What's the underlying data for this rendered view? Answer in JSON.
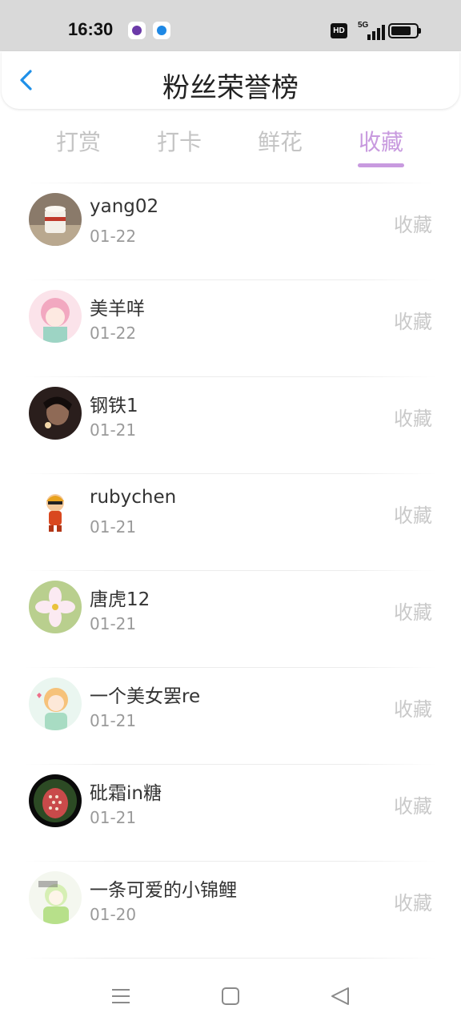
{
  "status_bar": {
    "time": "16:30",
    "network_label": "HD",
    "signal_label": "5G",
    "icons": [
      "app-notification-icon",
      "app-notification-icon",
      "hd-icon",
      "signal-icon",
      "battery-icon"
    ]
  },
  "header": {
    "title": "粉丝荣誉榜",
    "back_icon": "back-arrow-icon"
  },
  "tabs": [
    {
      "label": "打赏",
      "active": false
    },
    {
      "label": "打卡",
      "active": false
    },
    {
      "label": "鲜花",
      "active": false
    },
    {
      "label": "收藏",
      "active": true
    }
  ],
  "list": [
    {
      "name": "yang02",
      "date": "01-22",
      "action": "收藏"
    },
    {
      "name": "美羊咩",
      "date": "01-22",
      "action": "收藏"
    },
    {
      "name": "钢铁1",
      "date": "01-21",
      "action": "收藏"
    },
    {
      "name": "rubychen",
      "date": "01-21",
      "action": "收藏"
    },
    {
      "name": "唐虎12",
      "date": "01-21",
      "action": "收藏"
    },
    {
      "name": "一个美女罢re",
      "date": "01-21",
      "action": "收藏"
    },
    {
      "name": "砒霜in糖",
      "date": "01-21",
      "action": "收藏"
    },
    {
      "name": "一条可爱的小锦鲤",
      "date": "01-20",
      "action": "收藏"
    }
  ],
  "nav_bar": {
    "icons": [
      "menu-icon",
      "home-icon",
      "back-icon"
    ]
  },
  "colors": {
    "accent": "#c89adf",
    "back_arrow": "#1e8fe8",
    "inactive_tab": "#c4c4c4",
    "action_text": "#c9c9c9",
    "status_bar_bg": "#d9d9d9"
  }
}
